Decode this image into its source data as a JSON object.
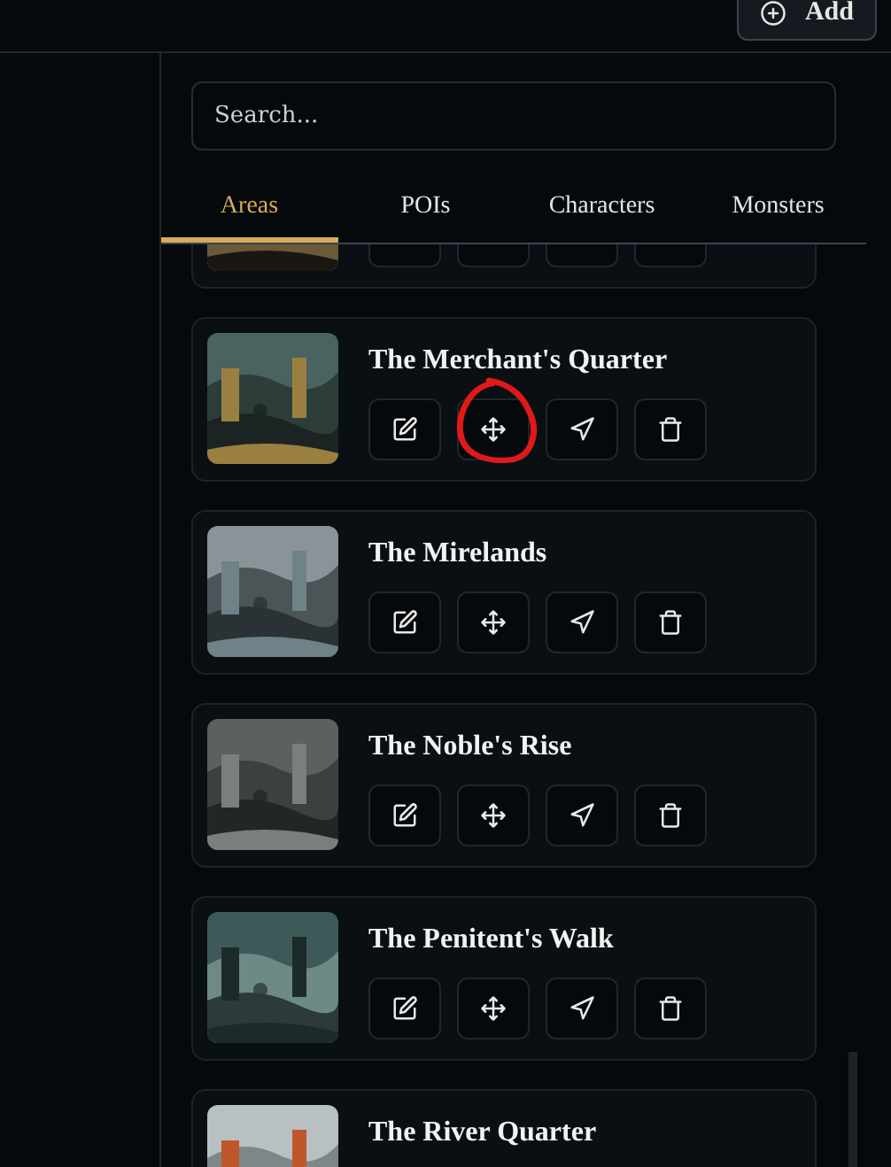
{
  "header": {
    "add_button": "Add"
  },
  "search": {
    "placeholder": "Search..."
  },
  "tabs": [
    {
      "label": "Areas",
      "selected": true
    },
    {
      "label": "POIs",
      "selected": false
    },
    {
      "label": "Characters",
      "selected": false
    },
    {
      "label": "Monsters",
      "selected": false
    }
  ],
  "areas": [
    {
      "circled": false,
      "kind": "picture"
    },
    {
      "title": "The Merchant's Quarter",
      "circled": true,
      "kind": "picture"
    },
    {
      "title": "The Mirelands",
      "circled": false,
      "kind": "picture"
    },
    {
      "title": "The Noble's Rise",
      "circled": false,
      "kind": "picture"
    },
    {
      "title": "The Penitent's Walk",
      "circled": false,
      "kind": "picture"
    },
    {
      "title": "The River Quarter",
      "circled": false,
      "kind": "picture"
    }
  ]
}
